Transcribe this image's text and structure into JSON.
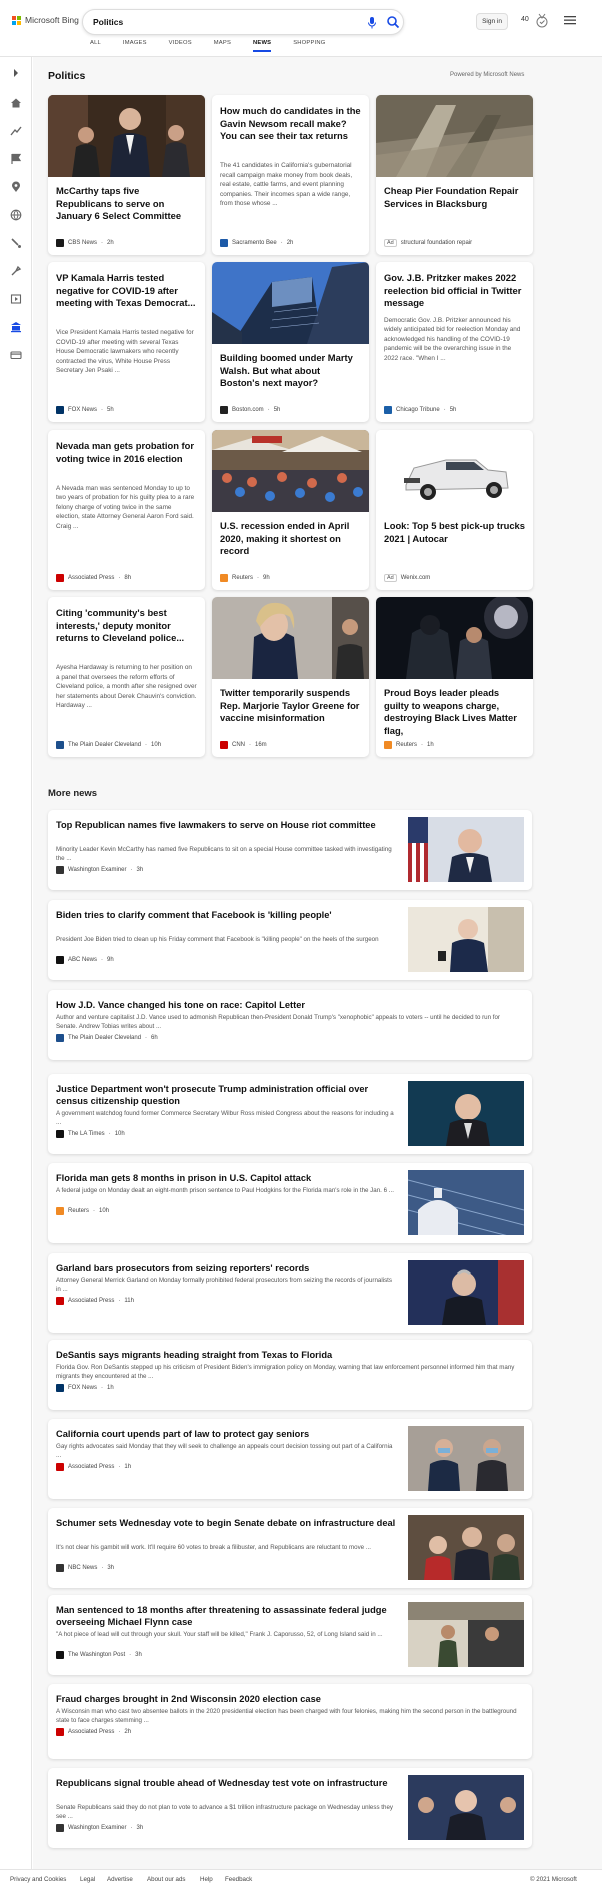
{
  "header": {
    "logo_text": "Microsoft Bing",
    "query": "Politics",
    "signin": "Sign in",
    "points": "40"
  },
  "tabs": [
    {
      "label": "ALL"
    },
    {
      "label": "IMAGES"
    },
    {
      "label": "VIDEOS"
    },
    {
      "label": "MAPS"
    },
    {
      "label": "NEWS",
      "active": true
    },
    {
      "label": "SHOPPING"
    }
  ],
  "section": {
    "title": "Politics",
    "powered": "Powered by Microsoft News"
  },
  "cards": [
    {
      "title": "McCarthy taps five Republicans to serve on January 6 Select Committee",
      "desc": "",
      "source": "CBS News",
      "age": "2h",
      "ad": false,
      "color": "#1a1a1a"
    },
    {
      "title": "How much do candidates in the Gavin Newsom recall make? You can see their tax returns",
      "desc": "The 41 candidates in California's gubernatorial recall campaign make money from book deals, real estate, cattle farms, and event planning companies. Their incomes span a wide range, from those whose ...",
      "source": "Sacramento Bee",
      "age": "2h",
      "ad": false,
      "color": "#1d5aa8"
    },
    {
      "title": "Cheap Pier Foundation Repair Services in Blacksburg",
      "desc": "",
      "source": "structural foundation repair",
      "age": "",
      "ad": true,
      "color": "#888"
    },
    {
      "title": "VP Kamala Harris tested negative for COVID-19 after meeting with Texas Democrat...",
      "desc": "Vice President Kamala Harris tested negative for COVID-19 after meeting with several Texas House Democratic lawmakers who recently contracted the virus, White House Press Secretary Jen Psaki ...",
      "source": "FOX News",
      "age": "5h",
      "ad": false,
      "color": "#003366"
    },
    {
      "title": "Building boomed under Marty Walsh. But what about Boston's next mayor?",
      "desc": "",
      "source": "Boston.com",
      "age": "5h",
      "ad": false,
      "color": "#222"
    },
    {
      "title": "Gov. J.B. Pritzker makes 2022 reelection bid official in Twitter message",
      "desc": "Democratic Gov. J.B. Pritzker announced his widely anticipated bid for reelection Monday and acknowledged his handling of the COVID-19 pandemic will be the overarching issue in the 2022 race. \"When I ...",
      "source": "Chicago Tribune",
      "age": "5h",
      "ad": false,
      "color": "#1b5fa8"
    },
    {
      "title": "Nevada man gets probation for voting twice in 2016 election",
      "desc": "A Nevada man was sentenced Monday to up to two years of probation for his guilty plea to a rare felony charge of voting twice in the same election, state Attorney General Aaron Ford said. Craig ...",
      "source": "Associated Press",
      "age": "8h",
      "ad": false,
      "color": "#cc0000"
    },
    {
      "title": "U.S. recession ended in April 2020, making it shortest on record",
      "desc": "",
      "source": "Reuters",
      "age": "9h",
      "ad": false,
      "color": "#f08a24"
    },
    {
      "title": "Look: Top 5 best pick-up trucks 2021 | Autocar",
      "desc": "",
      "source": "Wenix.com",
      "age": "",
      "ad": true,
      "color": "#888"
    },
    {
      "title": "Citing 'community's best interests,' deputy monitor returns to Cleveland police...",
      "desc": "Ayesha Hardaway is returning to her position on a panel that oversees the reform efforts of Cleveland police, a month after she resigned over her statements about Derek Chauvin's conviction. Hardaway ...",
      "source": "The Plain Dealer Cleveland",
      "age": "10h",
      "ad": false,
      "color": "#1d4f8c"
    },
    {
      "title": "Twitter temporarily suspends Rep. Marjorie Taylor Greene for vaccine misinformation",
      "desc": "",
      "source": "CNN",
      "age": "16m",
      "ad": false,
      "color": "#cc0000"
    },
    {
      "title": "Proud Boys leader pleads guilty to weapons charge, destroying Black Lives Matter flag,",
      "desc": "",
      "source": "Reuters",
      "age": "1h",
      "ad": false,
      "color": "#f08a24"
    }
  ],
  "more_news": {
    "title": "More news",
    "items": [
      {
        "title": "Top Republican names five lawmakers to serve on House riot committee",
        "desc": "Minority Leader Kevin McCarthy has named five Republicans to sit on a special House committee tasked with investigating the ...",
        "source": "Washington Examiner",
        "age": "3h",
        "color": "#333"
      },
      {
        "title": "Biden tries to clarify comment that Facebook is 'killing people'",
        "desc": "President Joe Biden tried to clean up his Friday comment that Facebook is \"killing people\" on the heels of the surgeon",
        "source": "ABC News",
        "age": "9h",
        "color": "#111"
      },
      {
        "title": "How J.D. Vance changed his tone on race: Capitol Letter",
        "desc": "Author and venture capitalist J.D. Vance used to admonish Republican then-President Donald Trump's \"xenophobic\" appeals to voters -- until he decided to run for Senate. Andrew Tobias writes about ...",
        "source": "The Plain Dealer Cleveland",
        "age": "6h",
        "color": "#1d4f8c"
      },
      {
        "title": "Justice Department won't prosecute Trump administration official over census citizenship question",
        "desc": "A government watchdog found former Commerce Secretary Wilbur Ross misled Congress about the reasons for including a ...",
        "source": "The LA Times",
        "age": "10h",
        "color": "#111"
      },
      {
        "title": "Florida man gets 8 months in prison in U.S. Capitol attack",
        "desc": "A federal judge on Monday dealt an eight-month prison sentence to Paul Hodgkins for the Florida man's role in the Jan. 6 ...",
        "source": "Reuters",
        "age": "10h",
        "color": "#f08a24"
      },
      {
        "title": "Garland bars prosecutors from seizing reporters' records",
        "desc": "Attorney General Merrick Garland on Monday formally prohibited federal prosecutors from seizing the records of journalists in ...",
        "source": "Associated Press",
        "age": "11h",
        "color": "#cc0000"
      },
      {
        "title": "DeSantis says migrants heading straight from Texas to Florida",
        "desc": "Florida Gov. Ron DeSantis stepped up his criticism of President Biden's immigration policy on Monday, warning that law enforcement personnel informed him that many migrants they encountered at the ...",
        "source": "FOX News",
        "age": "1h",
        "color": "#003366"
      },
      {
        "title": "California court upends part of law to protect gay seniors",
        "desc": "Gay rights advocates said Monday that they will seek to challenge an appeals court decision tossing out part of a California ...",
        "source": "Associated Press",
        "age": "1h",
        "color": "#cc0000"
      },
      {
        "title": "Schumer sets Wednesday vote to begin Senate debate on infrastructure deal",
        "desc": "It's not clear his gambit will work. It'll require 60 votes to break a filibuster, and Republicans are reluctant to move ...",
        "source": "NBC News",
        "age": "3h",
        "color": "#333"
      },
      {
        "title": "Man sentenced to 18 months after threatening to assassinate federal judge overseeing Michael Flynn case",
        "desc": "\"A hot piece of lead will cut through your skull. Your staff will be killed,\" Frank J. Caporusso, 52, of Long Island said in ...",
        "source": "The Washington Post",
        "age": "3h",
        "color": "#111"
      },
      {
        "title": "Fraud charges brought in 2nd Wisconsin 2020 election case",
        "desc": "A Wisconsin man who cast two absentee ballots in the 2020 presidential election has been charged with four felonies, making him the second person in the battleground state to face charges stemming ...",
        "source": "Associated Press",
        "age": "2h",
        "color": "#cc0000"
      },
      {
        "title": "Republicans signal trouble ahead of Wednesday test vote on infrastructure",
        "desc": "Senate Republicans said they do not plan to vote to advance a $1 trillion infrastructure package on Wednesday unless they see ...",
        "source": "Washington Examiner",
        "age": "3h",
        "color": "#333"
      }
    ]
  },
  "footer": {
    "links": [
      "Privacy and Cookies",
      "Legal",
      "Advertise",
      "About our ads",
      "Help",
      "Feedback"
    ],
    "copyright": "© 2021 Microsoft"
  },
  "colors": {
    "accent": "#174ae4",
    "page_bg": "#f7f7f7"
  }
}
